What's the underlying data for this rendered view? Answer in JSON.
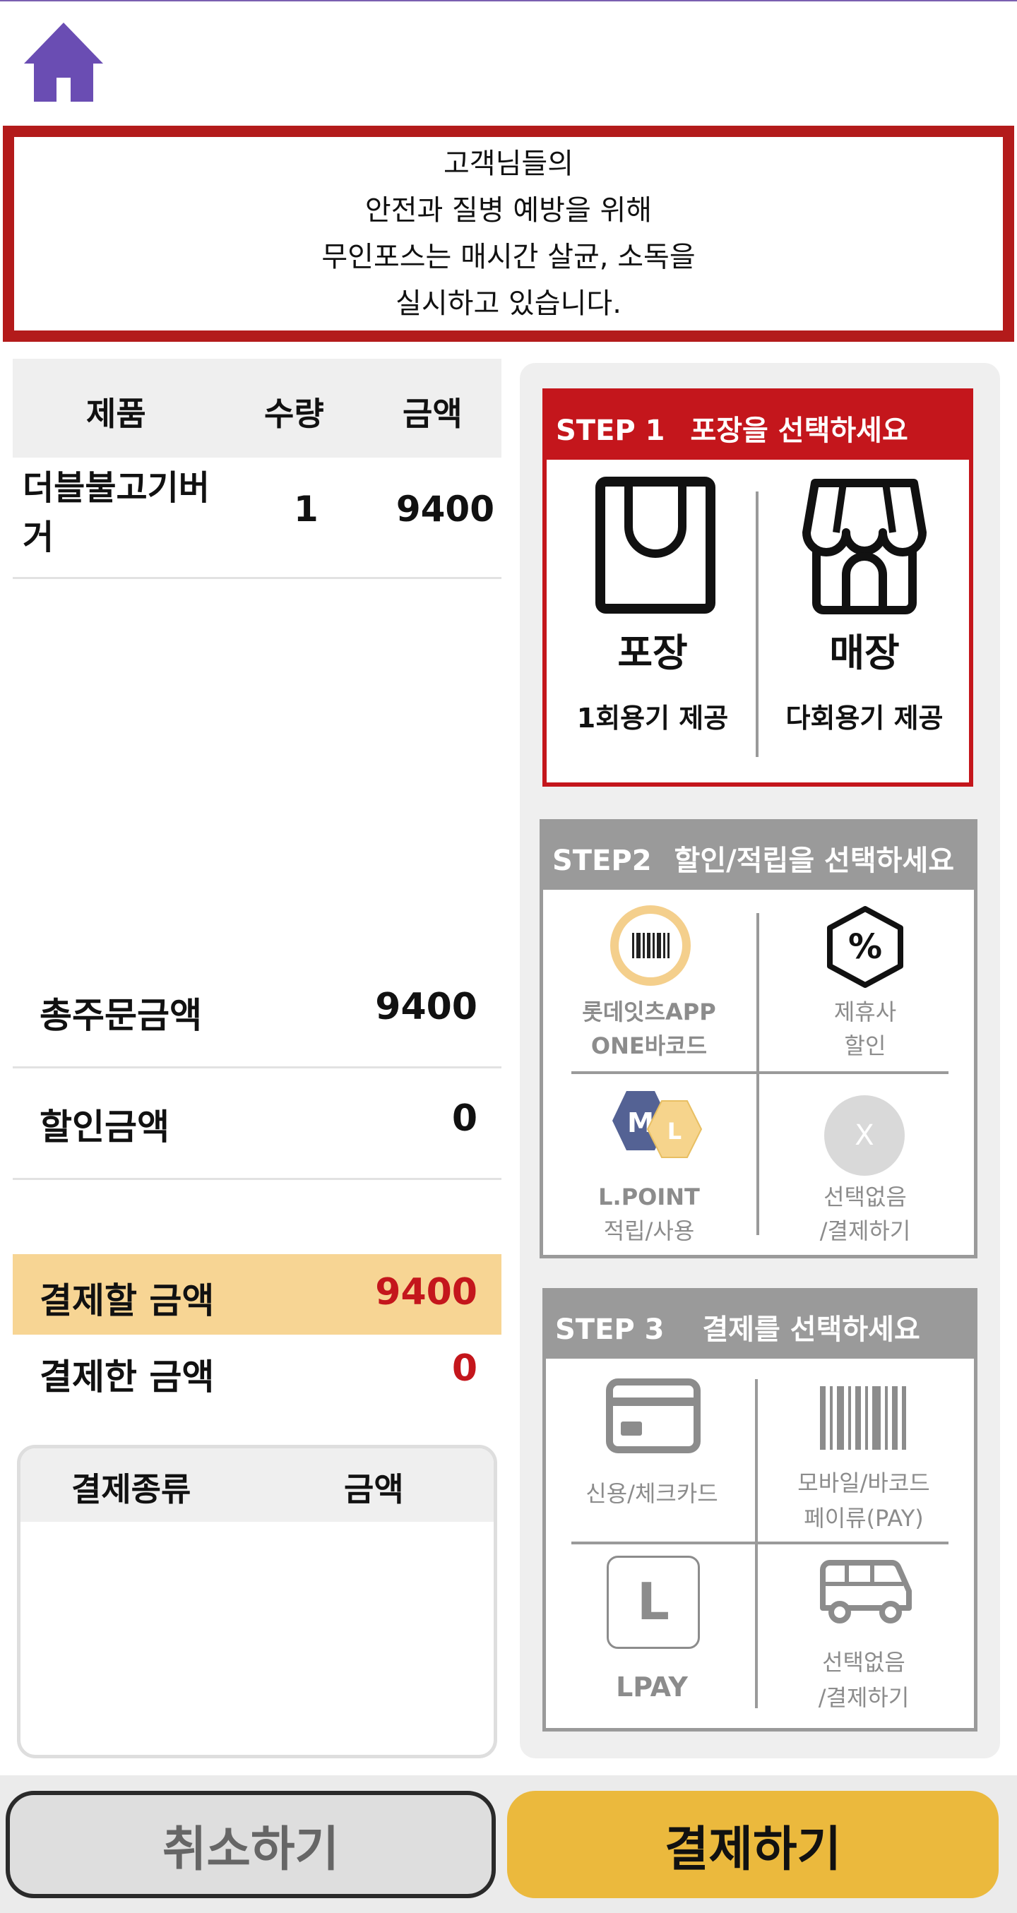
{
  "notice": {
    "lines": [
      "고객님들의",
      "안전과 질병 예방을 위해",
      "무인포스는 매시간 살균, 소독을",
      "실시하고 있습니다."
    ]
  },
  "order_table": {
    "headers": {
      "product": "제품",
      "qty": "수량",
      "amount": "금액"
    },
    "rows": [
      {
        "product": "더블불고기버거",
        "qty": "1",
        "amount": "9400"
      }
    ]
  },
  "summary": {
    "total_label": "총주문금액",
    "total_value": "9400",
    "discount_label": "할인금액",
    "discount_value": "0",
    "to_pay_label": "결제할 금액",
    "to_pay_value": "9400",
    "paid_label": "결제한 금액",
    "paid_value": "0"
  },
  "payment_table": {
    "type_header": "결제종류",
    "amount_header": "금액"
  },
  "step1": {
    "step": "STEP 1",
    "title": "포장을 선택하세요",
    "takeout": {
      "label": "포장",
      "sub": "1회용기 제공"
    },
    "dinein": {
      "label": "매장",
      "sub": "다회용기 제공"
    }
  },
  "step2": {
    "step": "STEP2",
    "title": "할인/적립을 선택하세요",
    "opt1": {
      "line1": "롯데잇츠APP",
      "line2": "ONE바코드"
    },
    "opt2": {
      "line1": "제휴사",
      "line2": "할인"
    },
    "opt3": {
      "line1": "L.POINT",
      "line2": "적립/사용",
      "m": "M",
      "l": "L"
    },
    "opt4": {
      "line1": "선택없음",
      "line2": "/결제하기",
      "x": "X"
    }
  },
  "step3": {
    "step": "STEP 3",
    "title": "결제를 선택하세요",
    "opt1": {
      "line1": "신용/체크카드"
    },
    "opt2": {
      "line1": "모바일/바코드",
      "line2": "페이류(PAY)"
    },
    "opt3": {
      "line1": "LPAY",
      "icon_letter": "L"
    },
    "opt4": {
      "line1": "선택없음",
      "line2": "/결제하기"
    }
  },
  "buttons": {
    "cancel": "취소하기",
    "pay": "결제하기"
  },
  "colors": {
    "accent_red": "#b31b1b",
    "pay_yellow": "#ebb93d",
    "highlight": "#f7d594",
    "home_purple": "#6a4db3"
  },
  "icons": [
    "home-icon",
    "shopping-bag-icon",
    "store-icon",
    "barcode-ring-icon",
    "percent-hexagon-icon",
    "lpoint-hexagon-icon",
    "close-circle-icon",
    "credit-card-icon",
    "barcode-icon",
    "lpay-icon",
    "bus-icon"
  ]
}
